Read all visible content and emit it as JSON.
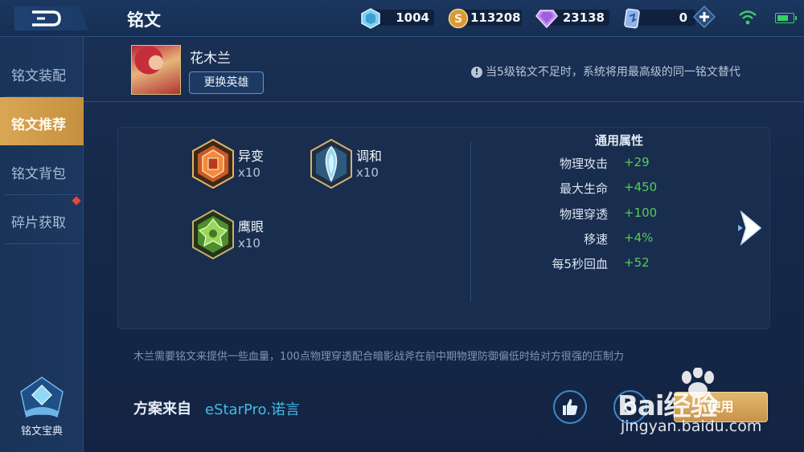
{
  "header": {
    "title": "铭文",
    "resources": {
      "crystal": "1004",
      "gold": "113208",
      "diamond": "23138",
      "card": "0"
    }
  },
  "sidebar": {
    "items": [
      {
        "label": "铭文装配",
        "active": false
      },
      {
        "label": "铭文推荐",
        "active": true
      },
      {
        "label": "铭文背包",
        "active": false
      },
      {
        "label": "碎片获取",
        "active": false
      }
    ],
    "codex_label": "铭文宝典"
  },
  "hero": {
    "name": "花木兰",
    "change_button": "更换英雄"
  },
  "notice": "当5级铭文不足时，系统将用最高级的同一铭文替代",
  "runes": [
    {
      "name": "异变",
      "qty": "x10",
      "color": "#d4652d"
    },
    {
      "name": "调和",
      "qty": "x10",
      "color": "#8ec9e3"
    },
    {
      "name": "鹰眼",
      "qty": "x10",
      "color": "#6bb84a"
    }
  ],
  "attributes": {
    "title": "通用属性",
    "rows": [
      {
        "key": "物理攻击",
        "value": "+29"
      },
      {
        "key": "最大生命",
        "value": "+450"
      },
      {
        "key": "物理穿透",
        "value": "+100"
      },
      {
        "key": "移速",
        "value": "+4%"
      },
      {
        "key": "每5秒回血",
        "value": "+52"
      }
    ]
  },
  "description": "木兰需要铭文来提供一些血量，100点物理穿透配合暗影战斧在前中期物理防御偏低时给对方很强的压制力",
  "footer": {
    "source_label": "方案来自",
    "source_name": "eStarPro.诺言",
    "use_button": "使用"
  },
  "watermark": {
    "brand": "Bai经验",
    "site": "jingyan.baidu.com"
  }
}
